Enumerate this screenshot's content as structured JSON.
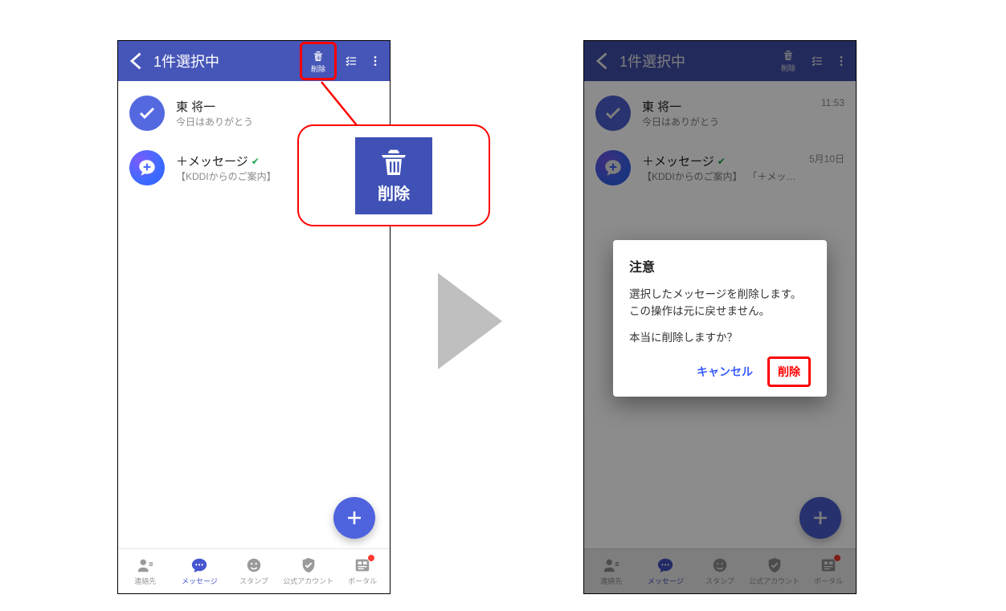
{
  "header": {
    "title": "1件選択中",
    "delete_label": "削除"
  },
  "messages": {
    "row1": {
      "name": "東 将一",
      "sub": "今日はありがとう",
      "time": "11:53"
    },
    "row2": {
      "name": "＋メッセージ",
      "sub_left": "【KDDIからのご案内】",
      "sub_right": "「＋メッセー…",
      "time": "5月10日"
    }
  },
  "nav": {
    "contacts": "連絡先",
    "messages": "メッセージ",
    "stamps": "スタンプ",
    "official": "公式アカウント",
    "portal": "ポータル"
  },
  "callout": {
    "label": "削除"
  },
  "dialog": {
    "title": "注意",
    "line1": "選択したメッセージを削除します。この操作は元に戻せません。",
    "line2": "本当に削除しますか？",
    "cancel": "キャンセル",
    "delete": "削除"
  }
}
